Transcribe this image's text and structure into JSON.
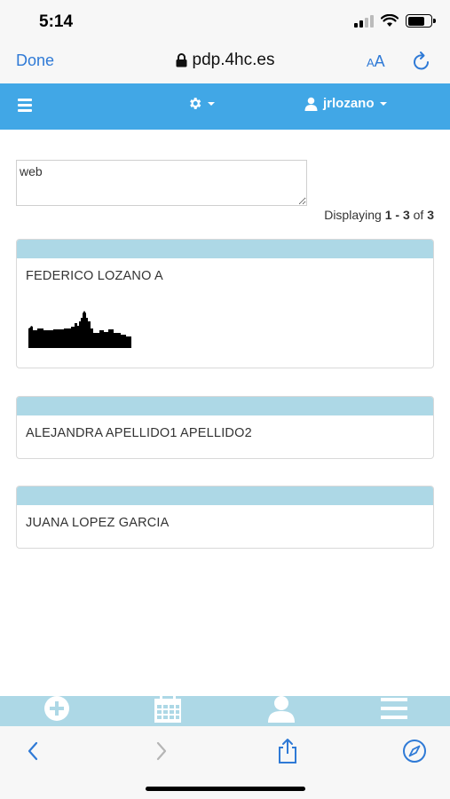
{
  "status_bar": {
    "time": "5:14"
  },
  "browser": {
    "done_label": "Done",
    "url": "pdp.4hc.es",
    "text_size_label_small": "A",
    "text_size_label_large": "A"
  },
  "app_nav": {
    "username": "jrlozano"
  },
  "search": {
    "value": "web",
    "placeholder": ""
  },
  "pagination": {
    "prefix": "Displaying ",
    "from": "1",
    "separator": " - ",
    "to": "3",
    "of_label": " of ",
    "total": "3"
  },
  "results": [
    {
      "name": "FEDERICO LOZANO A"
    },
    {
      "name": "ALEJANDRA APELLIDO1 APELLIDO2"
    },
    {
      "name": "JUANA LOPEZ GARCIA"
    }
  ],
  "bottom_tabs": [
    {
      "icon": "add-circle-icon"
    },
    {
      "icon": "calendar-icon"
    },
    {
      "icon": "user-icon"
    },
    {
      "icon": "menu-icon"
    }
  ],
  "colors": {
    "nav_blue": "#41a7e6",
    "card_header": "#add8e6",
    "ios_link": "#2f7ad6"
  }
}
